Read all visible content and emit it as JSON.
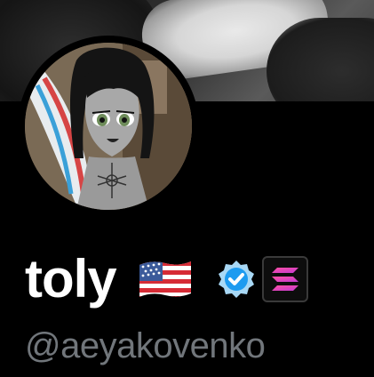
{
  "profile": {
    "display_name": "toly",
    "handle": "@aeyakovenko",
    "flag_emoji": "flag-usa-icon",
    "verified_icon": "verified-checkmark-icon",
    "affiliate_icon": "solana-logo-icon"
  },
  "colors": {
    "background": "#000000",
    "name_text": "#ffffff",
    "handle_text": "#71767b",
    "verified_blue": "#1d9bf0"
  }
}
